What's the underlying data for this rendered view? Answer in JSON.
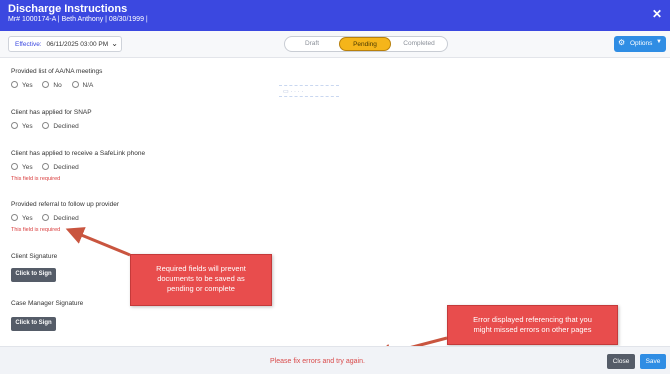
{
  "header": {
    "title": "Discharge Instructions",
    "subtitle": "Mr# 1000174-A | Beth Anthony | 08/30/1999 |",
    "close_icon": "close-icon"
  },
  "toolbar": {
    "effective_label": "Effective:",
    "effective_value": "06/11/2025 03:00 PM",
    "status_tabs": [
      "Draft",
      "Pending",
      "Completed"
    ],
    "active_status": "Pending",
    "options_label": "Options"
  },
  "questions": [
    {
      "label": "Provided list of AA/NA meetings",
      "options": [
        "Yes",
        "No",
        "N/A"
      ],
      "error": ""
    },
    {
      "label": "Client has applied for SNAP",
      "options": [
        "Yes",
        "Declined"
      ],
      "error": ""
    },
    {
      "label": "Client has applied to receive a SafeLink phone",
      "options": [
        "Yes",
        "Declined"
      ],
      "error": "This field is required"
    },
    {
      "label": "Provided referral to follow up provider",
      "options": [
        "Yes",
        "Declined"
      ],
      "error": "This field is required"
    }
  ],
  "signatures": [
    {
      "label": "Client Signature",
      "button": "Click to Sign"
    },
    {
      "label": "Case Manager Signature",
      "button": "Click to Sign"
    }
  ],
  "annotations": {
    "callout1": [
      "Required fields will prevent",
      "documents to be saved as",
      "pending or complete"
    ],
    "callout2": [
      "Error displayed referencing that you",
      "might missed errors on other pages"
    ]
  },
  "footer": {
    "message": "Please fix errors and try again.",
    "close_label": "Close",
    "save_label": "Save"
  },
  "colors": {
    "header": "#3b48e0",
    "pending": "#f5b51a",
    "primary": "#2f8de4",
    "error": "#d93b3b",
    "callout": "#e84d4d"
  }
}
